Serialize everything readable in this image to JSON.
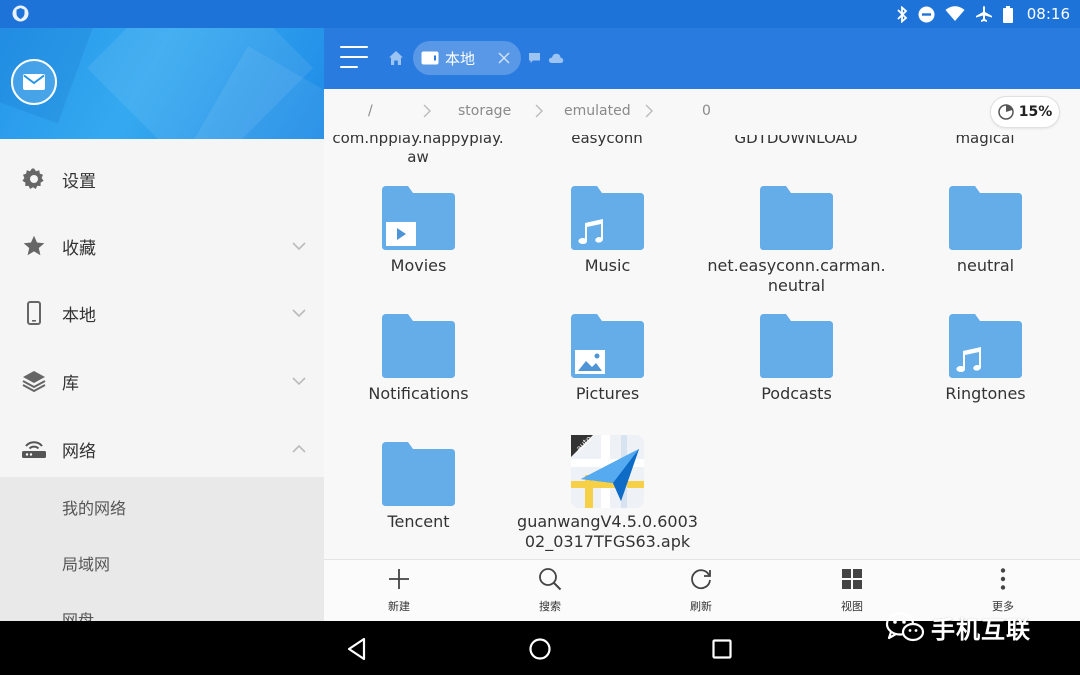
{
  "status_bar": {
    "time": "08:16",
    "icons": [
      "shield-icon",
      "bluetooth-icon",
      "do-not-disturb-icon",
      "wifi-icon",
      "airplane-icon",
      "battery-icon"
    ]
  },
  "drawer": {
    "header": {
      "avatar_icon": "mail-icon"
    },
    "items": [
      {
        "label": "设置",
        "icon": "gear-icon",
        "chevron": ""
      },
      {
        "label": "收藏",
        "icon": "star-icon",
        "chevron": "down"
      },
      {
        "label": "本地",
        "icon": "phone-icon",
        "chevron": "down"
      },
      {
        "label": "库",
        "icon": "layers-icon",
        "chevron": "down"
      },
      {
        "label": "网络",
        "icon": "router-icon",
        "chevron": "up"
      }
    ],
    "network_subitems": [
      {
        "label": "我的网络"
      },
      {
        "label": "局域网"
      },
      {
        "label": "网盘"
      }
    ]
  },
  "toolbar": {
    "active_tab": "本地",
    "icons": [
      "menu-icon",
      "home-icon",
      "close-icon",
      "chat-icon",
      "cloud-icon"
    ]
  },
  "path": {
    "crumbs": [
      "/",
      "storage",
      "emulated",
      "0"
    ],
    "usage": "15%"
  },
  "files": {
    "partial_row": [
      "com.hpplay.happyplay.\naw",
      "easyconn",
      "GDTDOWNLOAD",
      "magical"
    ],
    "items": [
      {
        "name": "Movies",
        "type": "folder",
        "badge": "video"
      },
      {
        "name": "Music",
        "type": "folder",
        "badge": "music"
      },
      {
        "name": "net.easyconn.carman.\nneutral",
        "type": "folder",
        "badge": ""
      },
      {
        "name": "neutral",
        "type": "folder",
        "badge": ""
      },
      {
        "name": "Notifications",
        "type": "folder",
        "badge": ""
      },
      {
        "name": "Pictures",
        "type": "folder",
        "badge": "picture"
      },
      {
        "name": "Podcasts",
        "type": "folder",
        "badge": ""
      },
      {
        "name": "Ringtones",
        "type": "folder",
        "badge": "music"
      },
      {
        "name": "Tencent",
        "type": "folder",
        "badge": ""
      },
      {
        "name": "guanwangV4.5.0.6003\n02_0317TFGS63.apk",
        "type": "apk",
        "badge": ""
      }
    ],
    "apk_icon_text": "auto"
  },
  "bottom_bar": {
    "actions": [
      {
        "label": "新建",
        "icon": "plus-icon"
      },
      {
        "label": "搜索",
        "icon": "search-icon"
      },
      {
        "label": "刷新",
        "icon": "refresh-icon"
      },
      {
        "label": "视图",
        "icon": "grid-view-icon"
      },
      {
        "label": "更多",
        "icon": "more-vert-icon"
      }
    ]
  },
  "watermark": {
    "text": "手机互联"
  },
  "colors": {
    "toolbar": "#2a7be0",
    "status_bar": "#1e73d9",
    "folder": "#64ade8",
    "folder_tab": "#5aa3e3"
  }
}
